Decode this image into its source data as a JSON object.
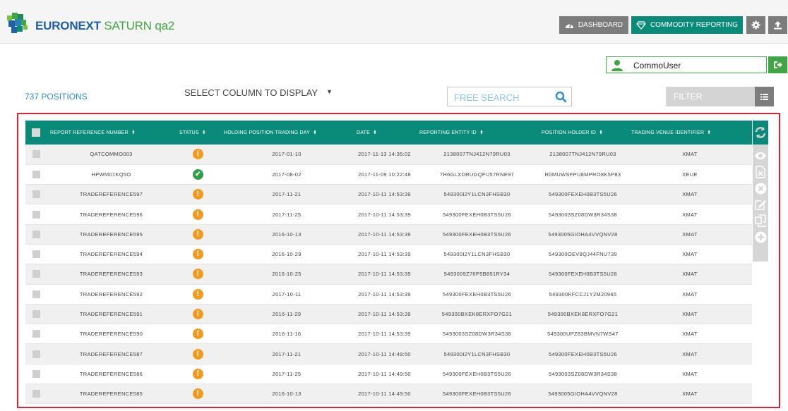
{
  "brand": {
    "part1": "EURONEXT",
    "part2": "SATURN",
    "part3": "qa2"
  },
  "nav": {
    "dashboard": "DASHBOARD",
    "commodity": "COMMODITY REPORTING"
  },
  "user": {
    "name": "CommoUser"
  },
  "toolbar": {
    "positions_count": "737 POSITIONS",
    "select_column": "SELECT COLUMN TO DISPLAY",
    "search_placeholder": "FREE SEARCH",
    "filter_label": "FILTER"
  },
  "colors": {
    "teal": "#0a8a79",
    "green": "#3fa742",
    "warn": "#f39a1d",
    "ok": "#2e9e49",
    "highlight": "#e12232"
  },
  "table": {
    "columns": [
      "REPORT REFERENCE NUMBER",
      "STATUS",
      "HOLDING POSITION TRADING DAY",
      "DATE",
      "REPORTING ENTITY ID",
      "POSITION HOLDER ID",
      "TRADING VENUE IDENTIFIER"
    ],
    "rows": [
      {
        "ref": "QATCOMMO003",
        "status": "warning",
        "day": "2017-01-10",
        "date": "2017-11-13 14:35:02",
        "entity": "2138007TNJ412N79RU03",
        "holder": "2138007TNJ412N79RU03",
        "venue": "XMAT"
      },
      {
        "ref": "HPWM01KQ5O",
        "status": "ok",
        "day": "2017-08-02",
        "date": "2017-11-09 10:22:48",
        "entity": "7H6GLXDRUGQFU57RNE97",
        "holder": "R0MUWSFPU8MPRO8K5P83",
        "venue": "XEUE"
      },
      {
        "ref": "TRADEREFERENCE597",
        "status": "warning",
        "day": "2017-11-21",
        "date": "2017-10-11 14:53:39",
        "entity": "549300I2Y1LCN3FHSB30",
        "holder": "549300FEXEH0B3TS5U26",
        "venue": "XMAT"
      },
      {
        "ref": "TRADEREFERENCE596",
        "status": "warning",
        "day": "2017-11-25",
        "date": "2017-10-11 14:53:39",
        "entity": "549300FEXEH0B3TS5U26",
        "holder": "5493003SZ08DW3R34S38",
        "venue": "XMAT"
      },
      {
        "ref": "TRADEREFERENCE595",
        "status": "warning",
        "day": "2016-10-13",
        "date": "2017-10-11 14:53:39",
        "entity": "549300FEXEH0B3TS5U26",
        "holder": "5493005GIOHA4VVQNV28",
        "venue": "XMAT"
      },
      {
        "ref": "TRADEREFERENCE594",
        "status": "warning",
        "day": "2016-10-29",
        "date": "2017-10-11 14:53:39",
        "entity": "549300I2Y1LCN3FHSB30",
        "holder": "549300OEV8QJ44FNU739",
        "venue": "XMAT"
      },
      {
        "ref": "TRADEREFERENCE593",
        "status": "warning",
        "day": "2016-10-25",
        "date": "2017-10-11 14:53:39",
        "entity": "5493009Z76P5B851RY34",
        "holder": "549300FEXEH0B3TS5U26",
        "venue": "XMAT"
      },
      {
        "ref": "TRADEREFERENCE592",
        "status": "warning",
        "day": "2017-10-11",
        "date": "2017-10-11 14:53:39",
        "entity": "549300FEXEH0B3TS5U26",
        "holder": "549300KFCCJ1Y2M20965",
        "venue": "XMAT"
      },
      {
        "ref": "TRADEREFERENCE591",
        "status": "warning",
        "day": "2016-11-29",
        "date": "2017-10-11 14:53:39",
        "entity": "549300BXEK8ERXFO7G21",
        "holder": "549300BXEK8ERXFO7G21",
        "venue": "XMAT"
      },
      {
        "ref": "TRADEREFERENCE590",
        "status": "warning",
        "day": "2016-11-16",
        "date": "2017-10-11 14:53:39",
        "entity": "5493003SZ08DW3R34S38",
        "holder": "549300UPZ83BMVN7WS47",
        "venue": "XMAT"
      },
      {
        "ref": "TRADEREFERENCE587",
        "status": "warning",
        "day": "2017-11-21",
        "date": "2017-10-11 14:49:50",
        "entity": "549300I2Y1LCN3FHSB30",
        "holder": "549300FEXEH0B3TS5U26",
        "venue": "XMAT"
      },
      {
        "ref": "TRADEREFERENCE586",
        "status": "warning",
        "day": "2017-11-25",
        "date": "2017-10-11 14:49:50",
        "entity": "549300FEXEH0B3TS5U26",
        "holder": "5493003SZ08DW3R34S38",
        "venue": "XMAT"
      },
      {
        "ref": "TRADEREFERENCE585",
        "status": "warning",
        "day": "2016-10-13",
        "date": "2017-10-11 14:49:50",
        "entity": "549300FEXEH0B3TS5U26",
        "holder": "5493005GIOHA4VVQNV28",
        "venue": "XMAT"
      }
    ]
  },
  "side_actions": [
    "refresh-icon",
    "eye-icon",
    "excel-export-icon",
    "delete-icon",
    "edit-icon",
    "copy-icon",
    "add-icon"
  ]
}
